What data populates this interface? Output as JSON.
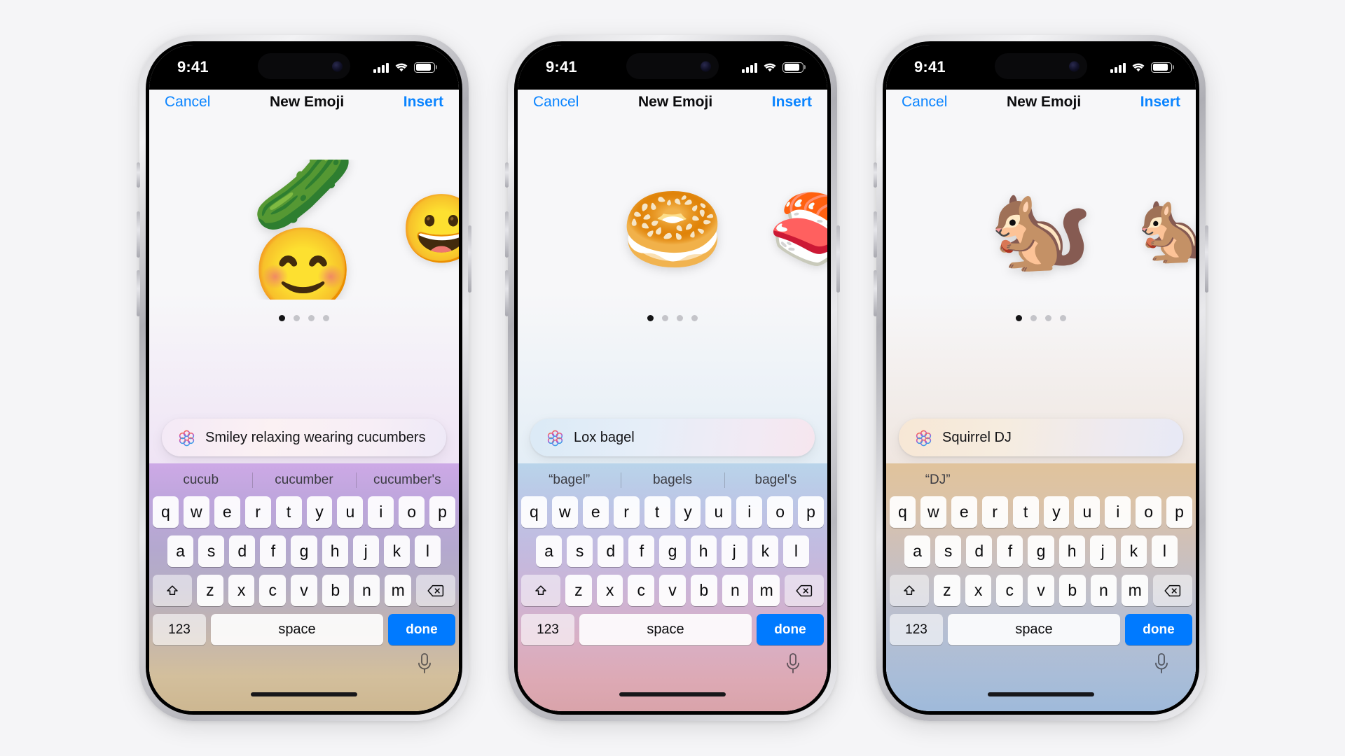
{
  "status_bar": {
    "time": "9:41",
    "signal_icon": "cellular-signal-icon",
    "wifi_icon": "wifi-icon",
    "battery_icon": "battery-icon"
  },
  "nav": {
    "cancel_label": "Cancel",
    "title": "New Emoji",
    "insert_label": "Insert"
  },
  "keyboard": {
    "row1": [
      "q",
      "w",
      "e",
      "r",
      "t",
      "y",
      "u",
      "i",
      "o",
      "p"
    ],
    "row2": [
      "a",
      "s",
      "d",
      "f",
      "g",
      "h",
      "j",
      "k",
      "l"
    ],
    "row3": [
      "z",
      "x",
      "c",
      "v",
      "b",
      "n",
      "m"
    ],
    "shift_label": "⇧",
    "backspace_label": "⌫",
    "numeric_label": "123",
    "space_label": "space",
    "done_label": "done",
    "mic_icon": "microphone-icon"
  },
  "phones": [
    {
      "id": "phone-cucumber",
      "prompt": {
        "text": "Smiley relaxing wearing cucumbers",
        "icon": "apple-intelligence-icon"
      },
      "emoji_main": "🥒😊",
      "emoji_main_label": "smiley-with-cucumbers-genmoji",
      "emoji_next": "😀",
      "emoji_next_label": "smiley-cucumber-variant",
      "dots": {
        "count": 4,
        "active": 0
      },
      "suggestions": [
        "cucub",
        "cucumber",
        "cucumber's"
      ],
      "theme": {
        "canvas_bottom": "#efe4f5",
        "prompt_gradient": "linear-gradient(100deg,#f4e9f6 0%,#fbf1f3 38%,#f7eef6 72%,#eee9f7 100%)",
        "keyboard_gradient": "linear-gradient(180deg,#cda9e6 0%,#bfa6dd 14%,#b4a8cf 34%,#b5aec3 50%,#c3b5ae 68%,#d3bf9c 86%,#cdb791 100%)"
      }
    },
    {
      "id": "phone-bagel",
      "prompt": {
        "text": "Lox bagel",
        "icon": "apple-intelligence-icon"
      },
      "emoji_main": "🥯",
      "emoji_main_label": "lox-bagel-genmoji",
      "emoji_next": "🍣",
      "emoji_next_label": "lox-bagel-variant",
      "dots": {
        "count": 4,
        "active": 0
      },
      "suggestions": [
        "“bagel”",
        "bagels",
        "bagel's"
      ],
      "theme": {
        "canvas_bottom": "#e4eef6",
        "prompt_gradient": "linear-gradient(100deg,#dbeaf6 0%,#e6eef8 40%,#f2eaf4 78%,#f6e6ee 100%)",
        "keyboard_gradient": "linear-gradient(180deg,#b9d4ea 0%,#bcc6e6 16%,#c2bbe0 34%,#ccb4d6 52%,#d9afc4 72%,#dda9b4 88%,#d9a3aa 100%)"
      }
    },
    {
      "id": "phone-squirrel",
      "prompt": {
        "text": "Squirrel DJ",
        "icon": "apple-intelligence-icon"
      },
      "emoji_main": "🐿️",
      "emoji_main_label": "squirrel-dj-genmoji",
      "emoji_next": "🐿️",
      "emoji_next_label": "squirrel-dj-variant",
      "dots": {
        "count": 4,
        "active": 0
      },
      "suggestions": [
        "“DJ”",
        "",
        ""
      ],
      "theme": {
        "canvas_bottom": "#efe6e0",
        "prompt_gradient": "linear-gradient(100deg,#f7e7d5 0%,#f6ecdf 36%,#eeeaf0 74%,#e7e9f6 100%)",
        "keyboard_gradient": "linear-gradient(180deg,#e0c39c 0%,#dcc3a6 14%,#cfc0b8 32%,#c2c0c8 50%,#b5bed2 68%,#a9bdd8 86%,#9fbada 100%)"
      }
    }
  ]
}
